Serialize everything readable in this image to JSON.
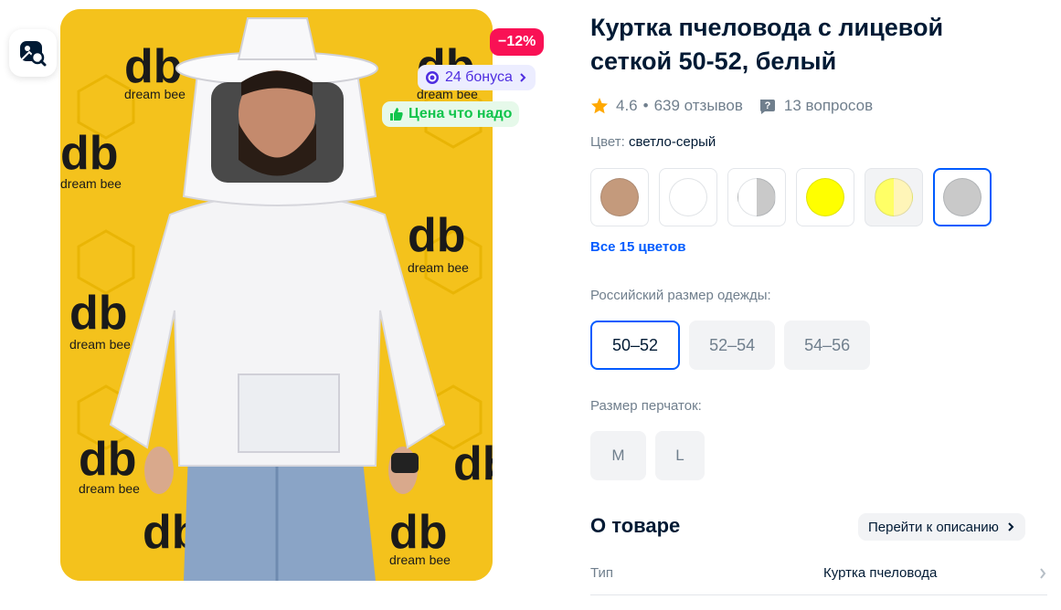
{
  "badges": {
    "discount": "−12%",
    "bonus": "24 бонуса",
    "price": "Цена что надо"
  },
  "photo": {
    "brand_text": "db",
    "brand_caption": "dream bee"
  },
  "product": {
    "title": "Куртка пчеловода с лицевой сеткой 50-52, белый",
    "rating": "4.6",
    "separator": "•",
    "reviews": "639 отзывов",
    "questions": "13 вопросов"
  },
  "color": {
    "label": "Цвет:",
    "value": "светло-серый",
    "swatches": [
      "#c49a7c",
      "#ffffff",
      "split-white-grey",
      "#ffff00",
      "split-yellow-cream",
      "#c9c9c9"
    ],
    "all_link": "Все 15 цветов"
  },
  "size": {
    "label": "Российский размер одежды:",
    "options": [
      "50–52",
      "52–54",
      "54–56"
    ],
    "selected": "50–52"
  },
  "gloves": {
    "label": "Размер перчаток:",
    "options": [
      "M",
      "L"
    ]
  },
  "about": {
    "title": "О товаре",
    "link": "Перейти к описанию",
    "rows": [
      {
        "key": "Тип",
        "value": "Куртка пчеловода"
      }
    ]
  },
  "colors": {
    "accent": "#005bff",
    "discount": "#f91155",
    "bonus": "#4f2ee0",
    "price_good": "#10c44c",
    "star": "#ffa800"
  }
}
